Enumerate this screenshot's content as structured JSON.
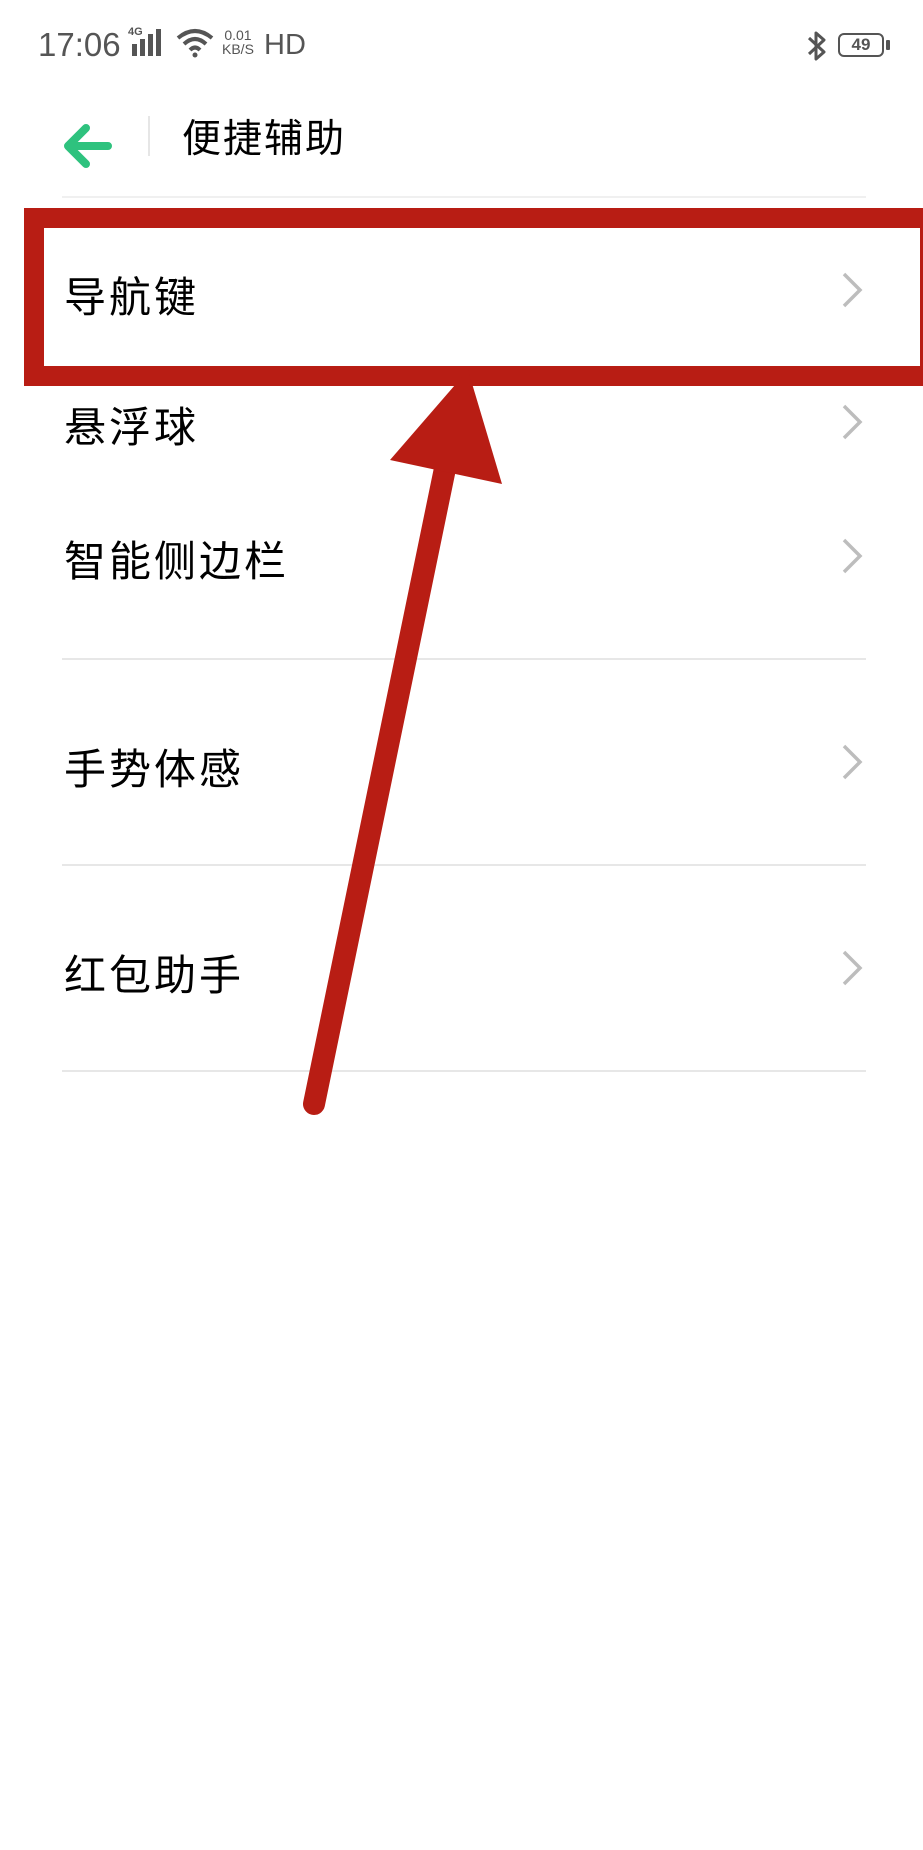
{
  "status_bar": {
    "time": "17:06",
    "network": "4G",
    "speed_top": "0.01",
    "speed_bottom": "KB/S",
    "hd": "HD",
    "battery": "49"
  },
  "header": {
    "title": "便捷辅助",
    "back_icon": "back-arrow-icon",
    "accent_color": "#2ec27e"
  },
  "menu": {
    "items": [
      {
        "label": "导航键"
      },
      {
        "label": "悬浮球"
      },
      {
        "label": "智能侧边栏"
      },
      {
        "label": "手势体感"
      },
      {
        "label": "红包助手"
      }
    ]
  },
  "annotation": {
    "color": "#b81d14",
    "highlighted_item": "导航键"
  }
}
